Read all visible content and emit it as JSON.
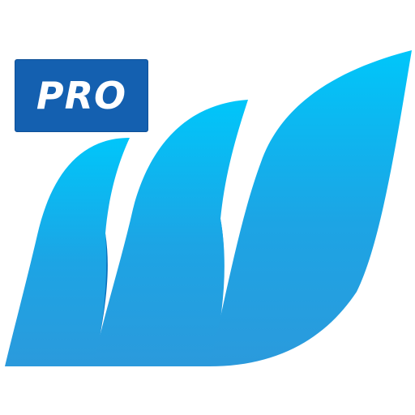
{
  "badge": {
    "label": "PRO",
    "background": "#1460B0",
    "border": "#0E4F96",
    "text_color": "#FFFFFF"
  },
  "logo": {
    "icon": "m-wave-logo-icon",
    "colors": {
      "light": "#00C6FA",
      "mid": "#1DA4E4",
      "base": "#2B9ADC",
      "shadow": "#0770BD"
    }
  }
}
